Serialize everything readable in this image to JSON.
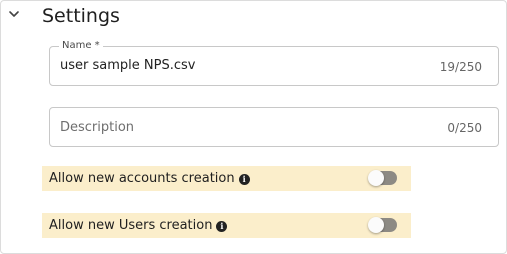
{
  "section": {
    "title": "Settings",
    "collapse_icon": "chevron-down-icon"
  },
  "name_field": {
    "label": "Name *",
    "value": "user sample NPS.csv",
    "counter": "19/250"
  },
  "description_field": {
    "placeholder": "Description",
    "value": "",
    "counter": "0/250"
  },
  "toggles": [
    {
      "label": "Allow new accounts creation",
      "icon": "info-icon",
      "enabled": false
    },
    {
      "label": "Allow new Users creation",
      "icon": "info-icon",
      "enabled": false
    }
  ],
  "colors": {
    "toggle_row_bg": "#fbeecb",
    "switch_off_track": "#8d8a84"
  }
}
